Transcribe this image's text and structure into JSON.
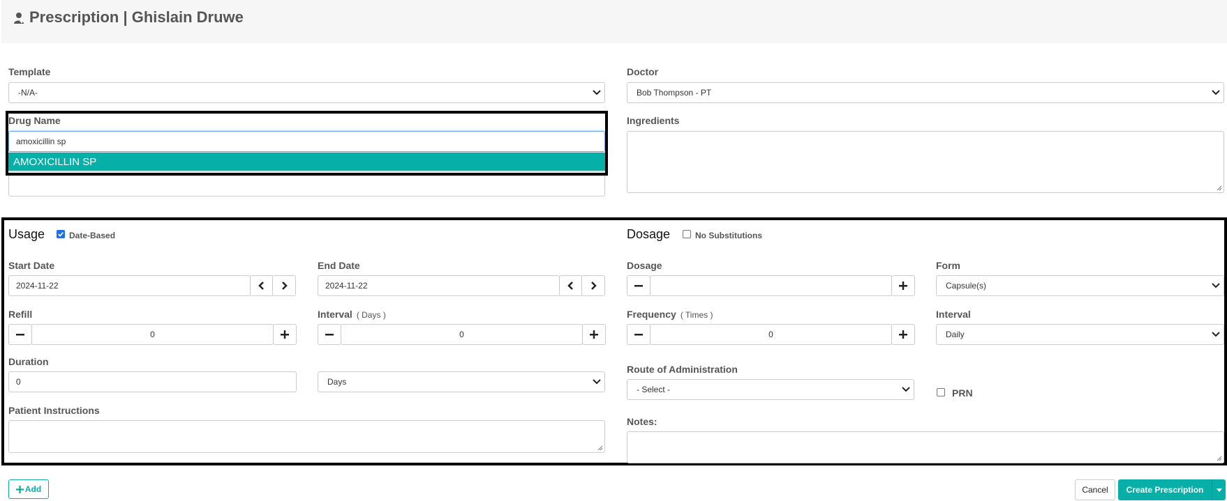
{
  "header": {
    "title": "Prescription | Ghislain Druwe",
    "icon": "user-doctor-icon"
  },
  "template": {
    "label": "Template",
    "value": "-N/A-"
  },
  "doctor": {
    "label": "Doctor",
    "value": "Bob Thompson - PT"
  },
  "drug": {
    "label": "Drug Name",
    "value": "amoxicillin sp",
    "suggestion": "AMOXICILLIN SP"
  },
  "ingredients": {
    "label": "Ingredients"
  },
  "usage": {
    "title": "Usage",
    "date_based_label": "Date-Based",
    "date_based_checked": true,
    "start_date_label": "Start Date",
    "start_date": "2024-11-22",
    "end_date_label": "End Date",
    "end_date": "2024-11-22",
    "refill_label": "Refill",
    "refill": "0",
    "interval_label": "Interval",
    "interval_unit": "( Days )",
    "interval": "0",
    "duration_label": "Duration",
    "duration": "0",
    "duration_unit": "Days",
    "patient_instructions_label": "Patient Instructions"
  },
  "dosage": {
    "title": "Dosage",
    "no_substitutions_label": "No Substitutions",
    "no_substitutions_checked": false,
    "dosage_label": "Dosage",
    "dosage": "",
    "form_label": "Form",
    "form": "Capsule(s)",
    "frequency_label": "Frequency",
    "frequency_unit": "( Times )",
    "frequency": "0",
    "interval_label": "Interval",
    "interval": "Daily",
    "route_label": "Route of Administration",
    "route": "- Select -",
    "prn_label": "PRN",
    "notes_label": "Notes:"
  },
  "footer": {
    "add_label": "Add",
    "cancel_label": "Cancel",
    "create_label": "Create Prescription"
  },
  "colors": {
    "accent": "#06b0a8",
    "highlight_border": "#000000",
    "checkbox": "#1a73e8"
  }
}
